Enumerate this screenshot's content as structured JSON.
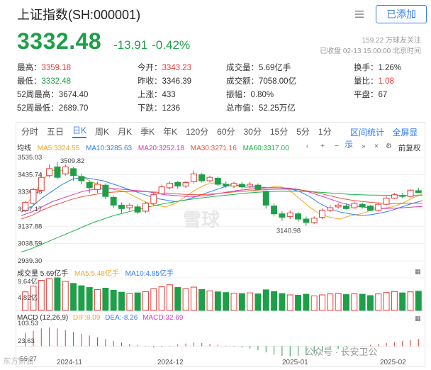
{
  "header": {
    "title": "上证指数(SH:000001)",
    "fav_button": "已添加",
    "price": "3332.48",
    "change": "-13.91",
    "change_pct": "-0.42%",
    "followers": "159.22 万球友关注",
    "status": "已收盘 02-13 15:00:00 北京时间"
  },
  "stats": [
    {
      "label": "最高",
      "value": "3359.18",
      "color": "red"
    },
    {
      "label": "今开",
      "value": "3343.23",
      "color": "red"
    },
    {
      "label": "成交量",
      "value": "5.69亿手",
      "color": ""
    },
    {
      "label": "换手",
      "value": "1.26%",
      "color": ""
    },
    {
      "label": "最低",
      "value": "3332.48",
      "color": "green"
    },
    {
      "label": "昨收",
      "value": "3346.39",
      "color": ""
    },
    {
      "label": "成交额",
      "value": "7058.00亿",
      "color": ""
    },
    {
      "label": "量比",
      "value": "1.08",
      "color": "red"
    },
    {
      "label": "52周最高",
      "value": "3674.40",
      "color": ""
    },
    {
      "label": "上涨",
      "value": "433",
      "color": ""
    },
    {
      "label": "振幅",
      "value": "0.80%",
      "color": ""
    },
    {
      "label": "平盘",
      "value": "67",
      "color": ""
    },
    {
      "label": "52周最低",
      "value": "2689.70",
      "color": ""
    },
    {
      "label": "下跌",
      "value": "1236",
      "color": ""
    },
    {
      "label": "总市值",
      "value": "52.25万亿",
      "color": ""
    }
  ],
  "tabs": [
    "分时",
    "五日",
    "日K",
    "周K",
    "月K",
    "季K",
    "年K",
    "120分",
    "60分",
    "30分",
    "15分",
    "5分",
    "1分"
  ],
  "active_tab": "日K",
  "tab_right": [
    "区间统计",
    "全屏显示"
  ],
  "ma_legend": {
    "label": "均线",
    "items": [
      {
        "text": "MA5:3324.55",
        "color": "#f5a623"
      },
      {
        "text": "MA10:3285.63",
        "color": "#2f7df6"
      },
      {
        "text": "MA20:3252.18",
        "color": "#d63bb5"
      },
      {
        "text": "MA30:3271.16",
        "color": "#e8533a"
      },
      {
        "text": "MA60:3317.00",
        "color": "#22b14c"
      }
    ],
    "rehab": "前复权"
  },
  "volume_legend": {
    "label": "成交量 5.69亿手",
    "items": [
      {
        "text": "MA5:5.48亿手",
        "color": "#f5a623"
      },
      {
        "text": "MA10:4.85亿手",
        "color": "#2f7df6"
      }
    ]
  },
  "macd_legend": {
    "label": "MACD (12,26,9)",
    "items": [
      {
        "text": "DIF:8.09",
        "color": "#f5a623"
      },
      {
        "text": "DEA:-8.26",
        "color": "#2f7df6"
      },
      {
        "text": "MACD:32.69",
        "color": "#d63bb5"
      }
    ]
  },
  "icons": [
    "menu-icon",
    "chevron-left-icon",
    "plus-icon",
    "minus-icon",
    "chevron-right-icon",
    "double-chevron-right-icon",
    "close-icon",
    "settings-icon",
    "expand-icon"
  ],
  "watermarks": {
    "logo": "雪球",
    "wechat": "公众号 · 长安卫公",
    "source": "东方财富"
  },
  "chart_data": [
    {
      "type": "candlestick",
      "title": "",
      "y_ticks": [
        "3535.03",
        "3435.74",
        "3336.46",
        "3237.17",
        "3137.88",
        "3038.59",
        "2939.30"
      ],
      "ylim": [
        2939.3,
        3535.03
      ],
      "x_ticks": [
        "2024-11",
        "2024-12",
        "2025-01",
        "2025-02"
      ],
      "annotations": [
        {
          "text": "3509.82",
          "type": "high"
        },
        {
          "text": "3140.98",
          "type": "low"
        }
      ],
      "colors": {
        "up": "#e83a35",
        "down": "#1e9f49"
      },
      "series": [
        {
          "name": "MA5",
          "values": [
            3240,
            3300,
            3400,
            3460,
            3460,
            3440,
            3420,
            3390,
            3370,
            3350,
            3340,
            3310,
            3280,
            3260,
            3250,
            3270,
            3310,
            3350,
            3380,
            3390,
            3380,
            3370,
            3360,
            3360,
            3360,
            3370,
            3350,
            3300,
            3250,
            3210,
            3190,
            3180,
            3200,
            3210,
            3230,
            3240,
            3250,
            3270,
            3300,
            3324.55
          ]
        },
        {
          "name": "MA10",
          "values": [
            3220,
            3250,
            3300,
            3340,
            3380,
            3410,
            3420,
            3410,
            3400,
            3380,
            3360,
            3340,
            3320,
            3300,
            3290,
            3280,
            3290,
            3310,
            3330,
            3350,
            3370,
            3375,
            3370,
            3365,
            3360,
            3360,
            3355,
            3340,
            3310,
            3270,
            3240,
            3220,
            3210,
            3200,
            3205,
            3215,
            3230,
            3250,
            3270,
            3285.63
          ]
        },
        {
          "name": "MA20",
          "values": [
            3200,
            3220,
            3250,
            3280,
            3300,
            3320,
            3340,
            3350,
            3355,
            3355,
            3350,
            3345,
            3340,
            3330,
            3320,
            3315,
            3310,
            3310,
            3315,
            3325,
            3335,
            3345,
            3350,
            3355,
            3360,
            3360,
            3358,
            3350,
            3335,
            3315,
            3295,
            3275,
            3260,
            3250,
            3245,
            3240,
            3242,
            3245,
            3249,
            3252.18
          ]
        },
        {
          "name": "MA30",
          "values": [
            3180,
            3200,
            3230,
            3255,
            3275,
            3295,
            3310,
            3320,
            3330,
            3335,
            3338,
            3340,
            3338,
            3335,
            3330,
            3325,
            3322,
            3320,
            3322,
            3326,
            3332,
            3338,
            3342,
            3346,
            3350,
            3352,
            3352,
            3348,
            3340,
            3328,
            3314,
            3300,
            3290,
            3282,
            3276,
            3272,
            3270,
            3270,
            3271,
            3271.16
          ]
        },
        {
          "name": "MA60",
          "values": [
            2990,
            3010,
            3035,
            3060,
            3085,
            3110,
            3135,
            3160,
            3180,
            3200,
            3215,
            3230,
            3245,
            3258,
            3270,
            3280,
            3290,
            3298,
            3305,
            3312,
            3318,
            3324,
            3330,
            3334,
            3338,
            3340,
            3341,
            3340,
            3338,
            3334,
            3330,
            3326,
            3322,
            3320,
            3318,
            3317,
            3316,
            3316,
            3317,
            3317.0
          ]
        }
      ],
      "candles": [
        {
          "o": 3230,
          "c": 3275,
          "h": 3285,
          "l": 3220
        },
        {
          "o": 3270,
          "c": 3350,
          "h": 3360,
          "l": 3260
        },
        {
          "o": 3345,
          "c": 3420,
          "h": 3445,
          "l": 3340
        },
        {
          "o": 3430,
          "c": 3470,
          "h": 3495,
          "l": 3420
        },
        {
          "o": 3480,
          "c": 3420,
          "h": 3509.82,
          "l": 3410
        },
        {
          "o": 3440,
          "c": 3480,
          "h": 3495,
          "l": 3430
        },
        {
          "o": 3470,
          "c": 3430,
          "h": 3480,
          "l": 3400
        },
        {
          "o": 3425,
          "c": 3400,
          "h": 3440,
          "l": 3380
        },
        {
          "o": 3390,
          "c": 3360,
          "h": 3400,
          "l": 3330
        },
        {
          "o": 3350,
          "c": 3380,
          "h": 3395,
          "l": 3330
        },
        {
          "o": 3375,
          "c": 3310,
          "h": 3385,
          "l": 3295
        },
        {
          "o": 3305,
          "c": 3260,
          "h": 3315,
          "l": 3245
        },
        {
          "o": 3260,
          "c": 3240,
          "h": 3275,
          "l": 3215
        },
        {
          "o": 3245,
          "c": 3260,
          "h": 3270,
          "l": 3230
        },
        {
          "o": 3250,
          "c": 3220,
          "h": 3265,
          "l": 3210
        },
        {
          "o": 3225,
          "c": 3270,
          "h": 3280,
          "l": 3215
        },
        {
          "o": 3270,
          "c": 3320,
          "h": 3330,
          "l": 3260
        },
        {
          "o": 3325,
          "c": 3365,
          "h": 3378,
          "l": 3320
        },
        {
          "o": 3360,
          "c": 3385,
          "h": 3395,
          "l": 3350
        },
        {
          "o": 3390,
          "c": 3370,
          "h": 3400,
          "l": 3355
        },
        {
          "o": 3370,
          "c": 3390,
          "h": 3400,
          "l": 3360
        },
        {
          "o": 3395,
          "c": 3440,
          "h": 3460,
          "l": 3385
        },
        {
          "o": 3435,
          "c": 3400,
          "h": 3445,
          "l": 3390
        },
        {
          "o": 3400,
          "c": 3420,
          "h": 3430,
          "l": 3390
        },
        {
          "o": 3415,
          "c": 3380,
          "h": 3425,
          "l": 3370
        },
        {
          "o": 3380,
          "c": 3370,
          "h": 3395,
          "l": 3360
        },
        {
          "o": 3370,
          "c": 3385,
          "h": 3395,
          "l": 3360
        },
        {
          "o": 3380,
          "c": 3365,
          "h": 3392,
          "l": 3355
        },
        {
          "o": 3370,
          "c": 3380,
          "h": 3392,
          "l": 3360
        },
        {
          "o": 3375,
          "c": 3350,
          "h": 3385,
          "l": 3345
        },
        {
          "o": 3340,
          "c": 3260,
          "h": 3345,
          "l": 3240
        },
        {
          "o": 3255,
          "c": 3210,
          "h": 3270,
          "l": 3195
        },
        {
          "o": 3210,
          "c": 3190,
          "h": 3225,
          "l": 3170
        },
        {
          "o": 3195,
          "c": 3215,
          "h": 3230,
          "l": 3180
        },
        {
          "o": 3210,
          "c": 3180,
          "h": 3220,
          "l": 3165
        },
        {
          "o": 3180,
          "c": 3160,
          "h": 3195,
          "l": 3140.98
        },
        {
          "o": 3160,
          "c": 3185,
          "h": 3195,
          "l": 3150
        },
        {
          "o": 3190,
          "c": 3230,
          "h": 3240,
          "l": 3180
        },
        {
          "o": 3230,
          "c": 3245,
          "h": 3260,
          "l": 3220
        },
        {
          "o": 3250,
          "c": 3260,
          "h": 3270,
          "l": 3240
        },
        {
          "o": 3255,
          "c": 3240,
          "h": 3270,
          "l": 3235
        },
        {
          "o": 3245,
          "c": 3270,
          "h": 3280,
          "l": 3240
        },
        {
          "o": 3265,
          "c": 3250,
          "h": 3275,
          "l": 3240
        },
        {
          "o": 3255,
          "c": 3230,
          "h": 3260,
          "l": 3225
        },
        {
          "o": 3230,
          "c": 3265,
          "h": 3275,
          "l": 3225
        },
        {
          "o": 3265,
          "c": 3300,
          "h": 3310,
          "l": 3260
        },
        {
          "o": 3300,
          "c": 3320,
          "h": 3330,
          "l": 3295
        },
        {
          "o": 3315,
          "c": 3310,
          "h": 3330,
          "l": 3300
        },
        {
          "o": 3310,
          "c": 3346,
          "h": 3350,
          "l": 3305
        },
        {
          "o": 3343.23,
          "c": 3332.48,
          "h": 3359.18,
          "l": 3332.48
        }
      ]
    },
    {
      "type": "bar",
      "title": "",
      "y_ticks": [
        "9.64亿",
        "4.82亿"
      ],
      "ylim": [
        0,
        9.64
      ],
      "series": [
        {
          "name": "成交量",
          "values": [
            5.5,
            7.2,
            8.9,
            9.4,
            9.64,
            8.6,
            8.0,
            7.3,
            6.8,
            6.2,
            6.6,
            6.0,
            5.4,
            5.0,
            5.2,
            5.6,
            6.4,
            7.0,
            7.6,
            6.8,
            6.4,
            6.9,
            6.2,
            5.8,
            5.5,
            5.3,
            5.1,
            5.0,
            5.2,
            4.9,
            6.1,
            5.6,
            5.0,
            4.6,
            4.5,
            4.8,
            4.3,
            4.6,
            4.9,
            5.0,
            4.7,
            4.9,
            4.8,
            4.4,
            4.9,
            5.3,
            5.6,
            5.2,
            5.5,
            5.69
          ]
        }
      ]
    },
    {
      "type": "bar",
      "title": "",
      "y_ticks": [
        "103.53",
        "23.63",
        "-56.27"
      ],
      "ylim": [
        -56.27,
        103.53
      ],
      "series": [
        {
          "name": "MACD",
          "values": [
            60,
            70,
            80,
            85,
            80,
            72,
            64,
            56,
            48,
            40,
            32,
            24,
            16,
            10,
            4,
            -2,
            -6,
            -4,
            2,
            8,
            12,
            16,
            14,
            10,
            6,
            2,
            -2,
            -6,
            -10,
            -18,
            -28,
            -38,
            -44,
            -46,
            -44,
            -40,
            -34,
            -26,
            -18,
            -12,
            -6,
            -2,
            2,
            6,
            10,
            14,
            18,
            24,
            28,
            32.69
          ]
        }
      ]
    }
  ]
}
